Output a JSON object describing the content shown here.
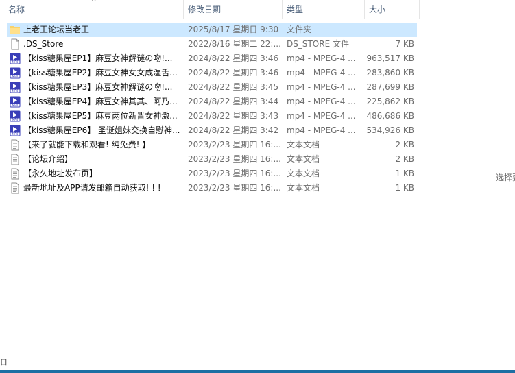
{
  "columns": {
    "name": "名称",
    "date": "修改日期",
    "type": "类型",
    "size": "大小"
  },
  "sort_indicator": "^",
  "files": [
    {
      "icon": "folder-icon",
      "name": "上老王论坛当老王",
      "date": "2025/8/17 星期日 9:30",
      "type": "文件夹",
      "size": "",
      "selected": true
    },
    {
      "icon": "file-icon",
      "name": ".DS_Store",
      "date": "2022/8/16 星期二 22:...",
      "type": "DS_STORE 文件",
      "size": "7 KB"
    },
    {
      "icon": "mp4-icon",
      "name": "【kiss糖果屋EP1】麻豆女神解谜の吻!...",
      "date": "2024/8/22 星期四 3:46",
      "type": "mp4 - MPEG-4 ...",
      "size": "963,517 KB"
    },
    {
      "icon": "mp4-icon",
      "name": "【kiss糖果屋EP2】麻豆女神女女咸湿舌...",
      "date": "2024/8/22 星期四 3:46",
      "type": "mp4 - MPEG-4 ...",
      "size": "283,860 KB"
    },
    {
      "icon": "mp4-icon",
      "name": "【kiss糖果屋EP3】麻豆女神解谜の吻!...",
      "date": "2024/8/22 星期四 3:45",
      "type": "mp4 - MPEG-4 ...",
      "size": "287,699 KB"
    },
    {
      "icon": "mp4-icon",
      "name": "【kiss糖果屋EP4】麻豆女神其其、阿乃...",
      "date": "2024/8/22 星期四 3:44",
      "type": "mp4 - MPEG-4 ...",
      "size": "225,862 KB"
    },
    {
      "icon": "mp4-icon",
      "name": "【kiss糖果屋EP5】麻豆两位新晋女神激...",
      "date": "2024/8/22 星期四 3:43",
      "type": "mp4 - MPEG-4 ...",
      "size": "486,686 KB"
    },
    {
      "icon": "mp4-icon",
      "name": "【kiss糖果屋EP6】 圣诞姐妹交换自慰神...",
      "date": "2024/8/22 星期四 3:42",
      "type": "mp4 - MPEG-4 ...",
      "size": "534,926 KB"
    },
    {
      "icon": "text-file-icon",
      "name": "【来了就能下载和观看! 纯免费! 】",
      "date": "2023/2/23 星期四 16:...",
      "type": "文本文档",
      "size": "2 KB"
    },
    {
      "icon": "text-file-icon",
      "name": "【论坛介绍】",
      "date": "2023/2/23 星期四 16:...",
      "type": "文本文档",
      "size": "2 KB"
    },
    {
      "icon": "text-file-icon",
      "name": "【永久地址发布页】",
      "date": "2023/2/23 星期四 16:...",
      "type": "文本文档",
      "size": "1 KB"
    },
    {
      "icon": "text-file-icon",
      "name": "最新地址及APP请发邮箱自动获取! ! !",
      "date": "2023/2/23 星期四 16:...",
      "type": "文本文档",
      "size": "1 KB"
    }
  ],
  "preview_pane": {
    "text": "选择要"
  },
  "status": {
    "left_text": "目"
  },
  "colors": {
    "selection": "#cce8ff",
    "header_text": "#4c607a",
    "accent": "#1d6fa3"
  }
}
